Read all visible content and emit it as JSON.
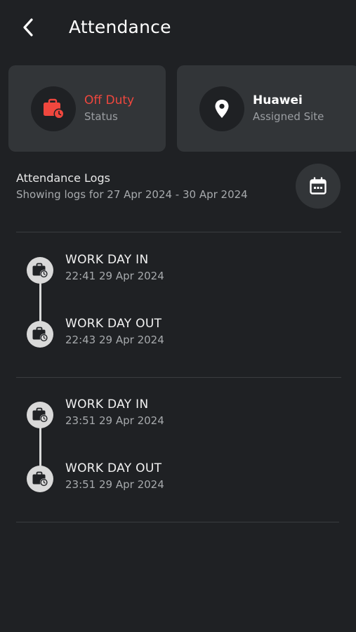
{
  "header": {
    "title": "Attendance",
    "back_icon": "chevron-left-icon"
  },
  "cards": {
    "status": {
      "value": "Off Duty",
      "label": "Status",
      "icon": "briefcase-clock-icon",
      "value_color": "#f0473e"
    },
    "site": {
      "value": "Huawei",
      "label": "Assigned Site",
      "icon": "location-pin-icon"
    }
  },
  "logs": {
    "title": "Attendance Logs",
    "subtitle": "Showing logs for 27 Apr 2024 - 30 Apr 2024",
    "calendar_icon": "calendar-icon",
    "groups": [
      {
        "entries": [
          {
            "title": "WORK DAY IN",
            "time": "22:41 29 Apr 2024",
            "icon": "briefcase-clock-icon"
          },
          {
            "title": "WORK DAY OUT",
            "time": "22:43 29 Apr 2024",
            "icon": "briefcase-clock-icon"
          }
        ]
      },
      {
        "entries": [
          {
            "title": "WORK DAY IN",
            "time": "23:51 29 Apr 2024",
            "icon": "briefcase-clock-icon"
          },
          {
            "title": "WORK DAY OUT",
            "time": "23:51 29 Apr 2024",
            "icon": "briefcase-clock-icon"
          }
        ]
      }
    ]
  },
  "colors": {
    "background": "#1f2124",
    "card": "#323538",
    "accent_red": "#f0473e",
    "timeline": "#d9d9d9"
  }
}
